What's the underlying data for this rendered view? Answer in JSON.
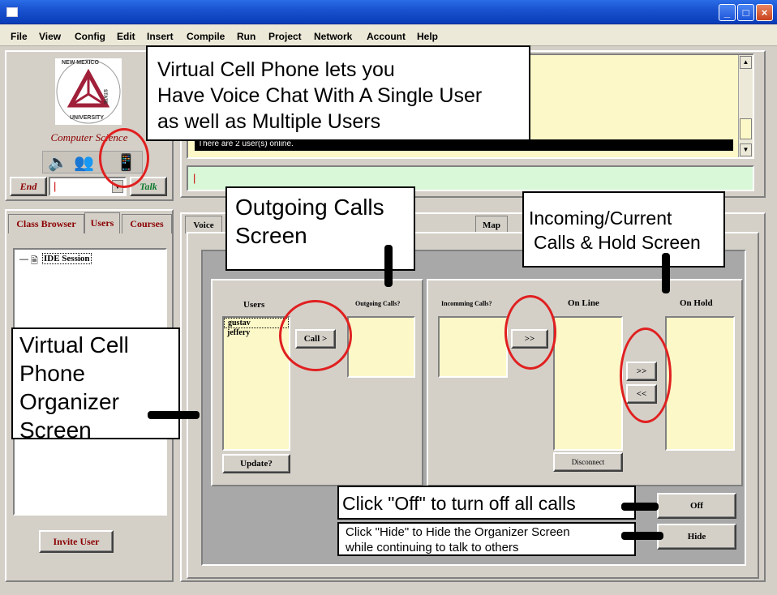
{
  "menu": [
    "File",
    "View",
    "Config",
    "Edit",
    "Insert",
    "Compile",
    "Run",
    "Project",
    "Network",
    "Account",
    "Help"
  ],
  "logo": {
    "text_top": "NEW MEXICO",
    "text_side": "STATE",
    "text_bottom": "UNIVERSITY"
  },
  "department": "Computer Science",
  "left_controls": {
    "end_label": "End",
    "talk_label": "Talk",
    "input_value": "|"
  },
  "chat": {
    "status_line": "There are 2 user(s) online.",
    "input_value": "|"
  },
  "left_tabs": [
    "Class Browser",
    "Users",
    "Courses"
  ],
  "session_tree": {
    "root_label": "IDE Session"
  },
  "invite_button": "Invite User",
  "right_tabs": {
    "voice": "Voice",
    "map": "Map"
  },
  "outgoing": {
    "users_header": "Users",
    "users": [
      "gustav",
      "jeffery"
    ],
    "call_button": "Call >",
    "outgoing_header": "Outgoing Calls?",
    "update_button": "Update?"
  },
  "incoming": {
    "incoming_header": "Incomming Calls?",
    "online_header": "On Line",
    "hold_header": "On Hold",
    "move_online_button": ">>",
    "to_hold_button": ">>",
    "from_hold_button": "<<",
    "disconnect_button": "Disconnect"
  },
  "off_button": "Off",
  "hide_button": "Hide",
  "annotations": {
    "top": [
      "Virtual Cell Phone lets you",
      "Have Voice Chat With A Single User",
      "as well as Multiple Users"
    ],
    "outgoing": [
      "Outgoing Calls",
      "Screen"
    ],
    "incoming": [
      "Incoming/Current",
      "Calls & Hold Screen"
    ],
    "organizer": [
      "Virtual Cell",
      "Phone",
      "Organizer",
      "Screen"
    ],
    "off": "Click \"Off\" to turn off all calls",
    "hide": [
      "Click \"Hide\" to Hide the Organizer Screen",
      "while continuing to talk to others"
    ]
  },
  "colors": {
    "highlight_ring": "#e02020",
    "titlebar": "#0a3cb7",
    "list_bg": "#fcf8c8",
    "input_bg": "#d8f8d8"
  }
}
